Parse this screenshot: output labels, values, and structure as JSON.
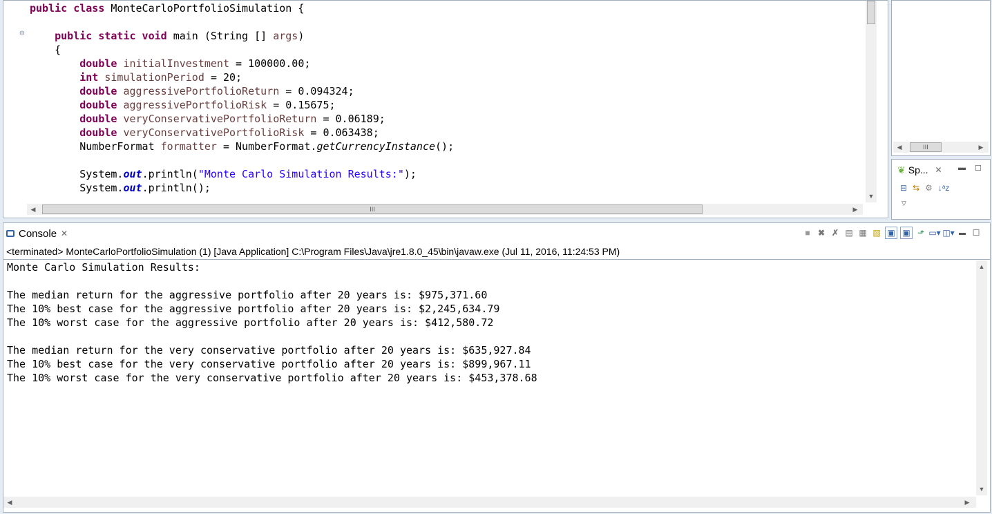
{
  "editor": {
    "lines": [
      [
        {
          "t": "public class ",
          "c": "kw"
        },
        {
          "t": "MonteCarloPortfolioSimulation {",
          "c": ""
        }
      ],
      [],
      [
        {
          "t": "    "
        },
        {
          "t": "public static void ",
          "c": "kw"
        },
        {
          "t": "main (String [] "
        },
        {
          "t": "args",
          "c": "var"
        },
        {
          "t": ")"
        }
      ],
      [
        {
          "t": "    {"
        }
      ],
      [
        {
          "t": "        "
        },
        {
          "t": "double ",
          "c": "kw"
        },
        {
          "t": "initialInvestment",
          "c": "var"
        },
        {
          "t": " = 100000.00;"
        }
      ],
      [
        {
          "t": "        "
        },
        {
          "t": "int ",
          "c": "kw"
        },
        {
          "t": "simulationPeriod",
          "c": "var"
        },
        {
          "t": " = 20;"
        }
      ],
      [
        {
          "t": "        "
        },
        {
          "t": "double ",
          "c": "kw"
        },
        {
          "t": "aggressivePortfolioReturn",
          "c": "var"
        },
        {
          "t": " = 0.094324;"
        }
      ],
      [
        {
          "t": "        "
        },
        {
          "t": "double ",
          "c": "kw"
        },
        {
          "t": "aggressivePortfolioRisk",
          "c": "var"
        },
        {
          "t": " = 0.15675;"
        }
      ],
      [
        {
          "t": "        "
        },
        {
          "t": "double ",
          "c": "kw"
        },
        {
          "t": "veryConservativePortfolioReturn",
          "c": "var"
        },
        {
          "t": " = 0.06189;"
        }
      ],
      [
        {
          "t": "        "
        },
        {
          "t": "double ",
          "c": "kw"
        },
        {
          "t": "veryConservativePortfolioRisk",
          "c": "var"
        },
        {
          "t": " = 0.063438;"
        }
      ],
      [
        {
          "t": "        NumberFormat "
        },
        {
          "t": "formatter",
          "c": "var"
        },
        {
          "t": " = NumberFormat."
        },
        {
          "t": "getCurrencyInstance",
          "c": "it"
        },
        {
          "t": "();"
        }
      ],
      [],
      [
        {
          "t": "        System."
        },
        {
          "t": "out",
          "c": "fld"
        },
        {
          "t": ".println("
        },
        {
          "t": "\"Monte Carlo Simulation Results:\"",
          "c": "str"
        },
        {
          "t": ");"
        }
      ],
      [
        {
          "t": "        System."
        },
        {
          "t": "out",
          "c": "fld"
        },
        {
          "t": ".println();"
        }
      ]
    ],
    "hscroll_thumb_label": "III"
  },
  "outline": {
    "hscroll_thumb_label": "III"
  },
  "sp_panel": {
    "tab_label": "Sp...",
    "close": "✕"
  },
  "console": {
    "tab_label": "Console",
    "close": "✕",
    "status": "<terminated> MonteCarloPortfolioSimulation (1) [Java Application] C:\\Program Files\\Java\\jre1.8.0_45\\bin\\javaw.exe (Jul 11, 2016, 11:24:53 PM)",
    "output": [
      "Monte Carlo Simulation Results:",
      "",
      "The median return for the aggressive portfolio after 20 years is: $975,371.60",
      "The 10% best case for the aggressive portfolio after 20 years is: $2,245,634.79",
      "The 10% worst case for the aggressive portfolio after 20 years is: $412,580.72",
      "",
      "The median return for the very conservative portfolio after 20 years is: $635,927.84",
      "The 10% best case for the very conservative portfolio after 20 years is: $899,967.11",
      "The 10% worst case for the very conservative portfolio after 20 years is: $453,378.68"
    ]
  },
  "icons": {
    "console": "console-icon",
    "terminate": "terminate-icon",
    "remove-launch": "remove-launch-icon",
    "remove-all": "remove-all-icon",
    "scroll-lock": "scroll-lock-icon",
    "word-wrap": "word-wrap-icon",
    "pin": "pin-console-icon",
    "display-selected": "display-selected-console-icon",
    "open-console": "open-console-icon"
  }
}
